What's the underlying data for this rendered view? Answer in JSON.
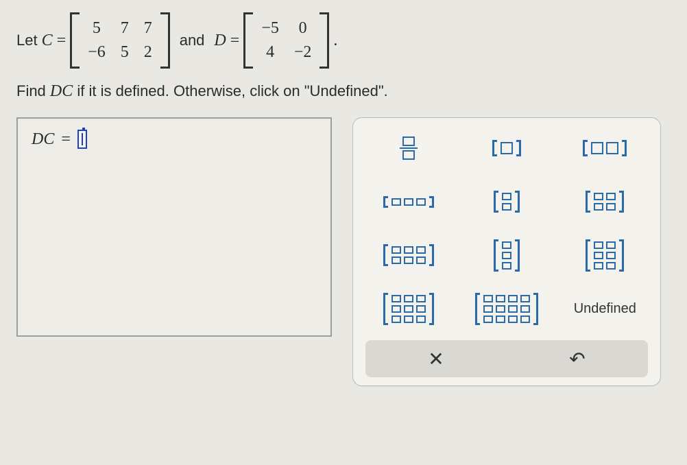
{
  "problem": {
    "let": "Let",
    "C_name": "C",
    "eq": "=",
    "and": "and",
    "D_name": "D",
    "period": ".",
    "matrix_C": [
      [
        "5",
        "7",
        "7"
      ],
      [
        "−6",
        "5",
        "2"
      ]
    ],
    "matrix_D": [
      [
        "−5",
        "0"
      ],
      [
        "4",
        "−2"
      ]
    ],
    "instruction_pre": "Find ",
    "instruction_target": "DC",
    "instruction_post": " if it is defined. Otherwise, click on \"Undefined\"."
  },
  "answer": {
    "label": "DC",
    "eq": "="
  },
  "palette": {
    "undefined_label": "Undefined",
    "clear_symbol": "✕",
    "undo_symbol": "↶"
  }
}
